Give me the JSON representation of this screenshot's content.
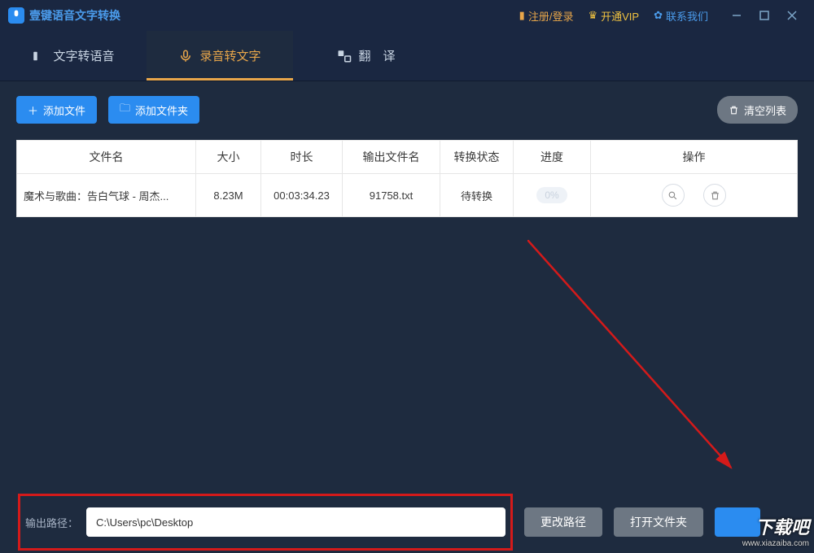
{
  "app": {
    "title": "壹键语音文字转换"
  },
  "titlebar": {
    "register": "注册/登录",
    "vip": "开通VIP",
    "contact": "联系我们"
  },
  "tabs": {
    "tts": "文字转语音",
    "stt": "录音转文字",
    "translate": "翻　译"
  },
  "toolbar": {
    "add_file": "添加文件",
    "add_folder": "添加文件夹",
    "clear_list": "清空列表"
  },
  "table": {
    "headers": {
      "filename": "文件名",
      "size": "大小",
      "duration": "时长",
      "output": "输出文件名",
      "status": "转换状态",
      "progress": "进度",
      "action": "操作"
    },
    "rows": [
      {
        "filename": "魔术与歌曲：告白气球 - 周杰...",
        "size": "8.23M",
        "duration": "00:03:34.23",
        "output": "91758.txt",
        "status": "待转换",
        "progress": "0%"
      }
    ]
  },
  "bottom": {
    "output_label": "输出路径：",
    "output_path": "C:\\Users\\pc\\Desktop",
    "change_path": "更改路径",
    "open_folder": "打开文件夹"
  },
  "watermark": {
    "line1": "下载吧",
    "line2": "www.xiazaiba.com"
  }
}
